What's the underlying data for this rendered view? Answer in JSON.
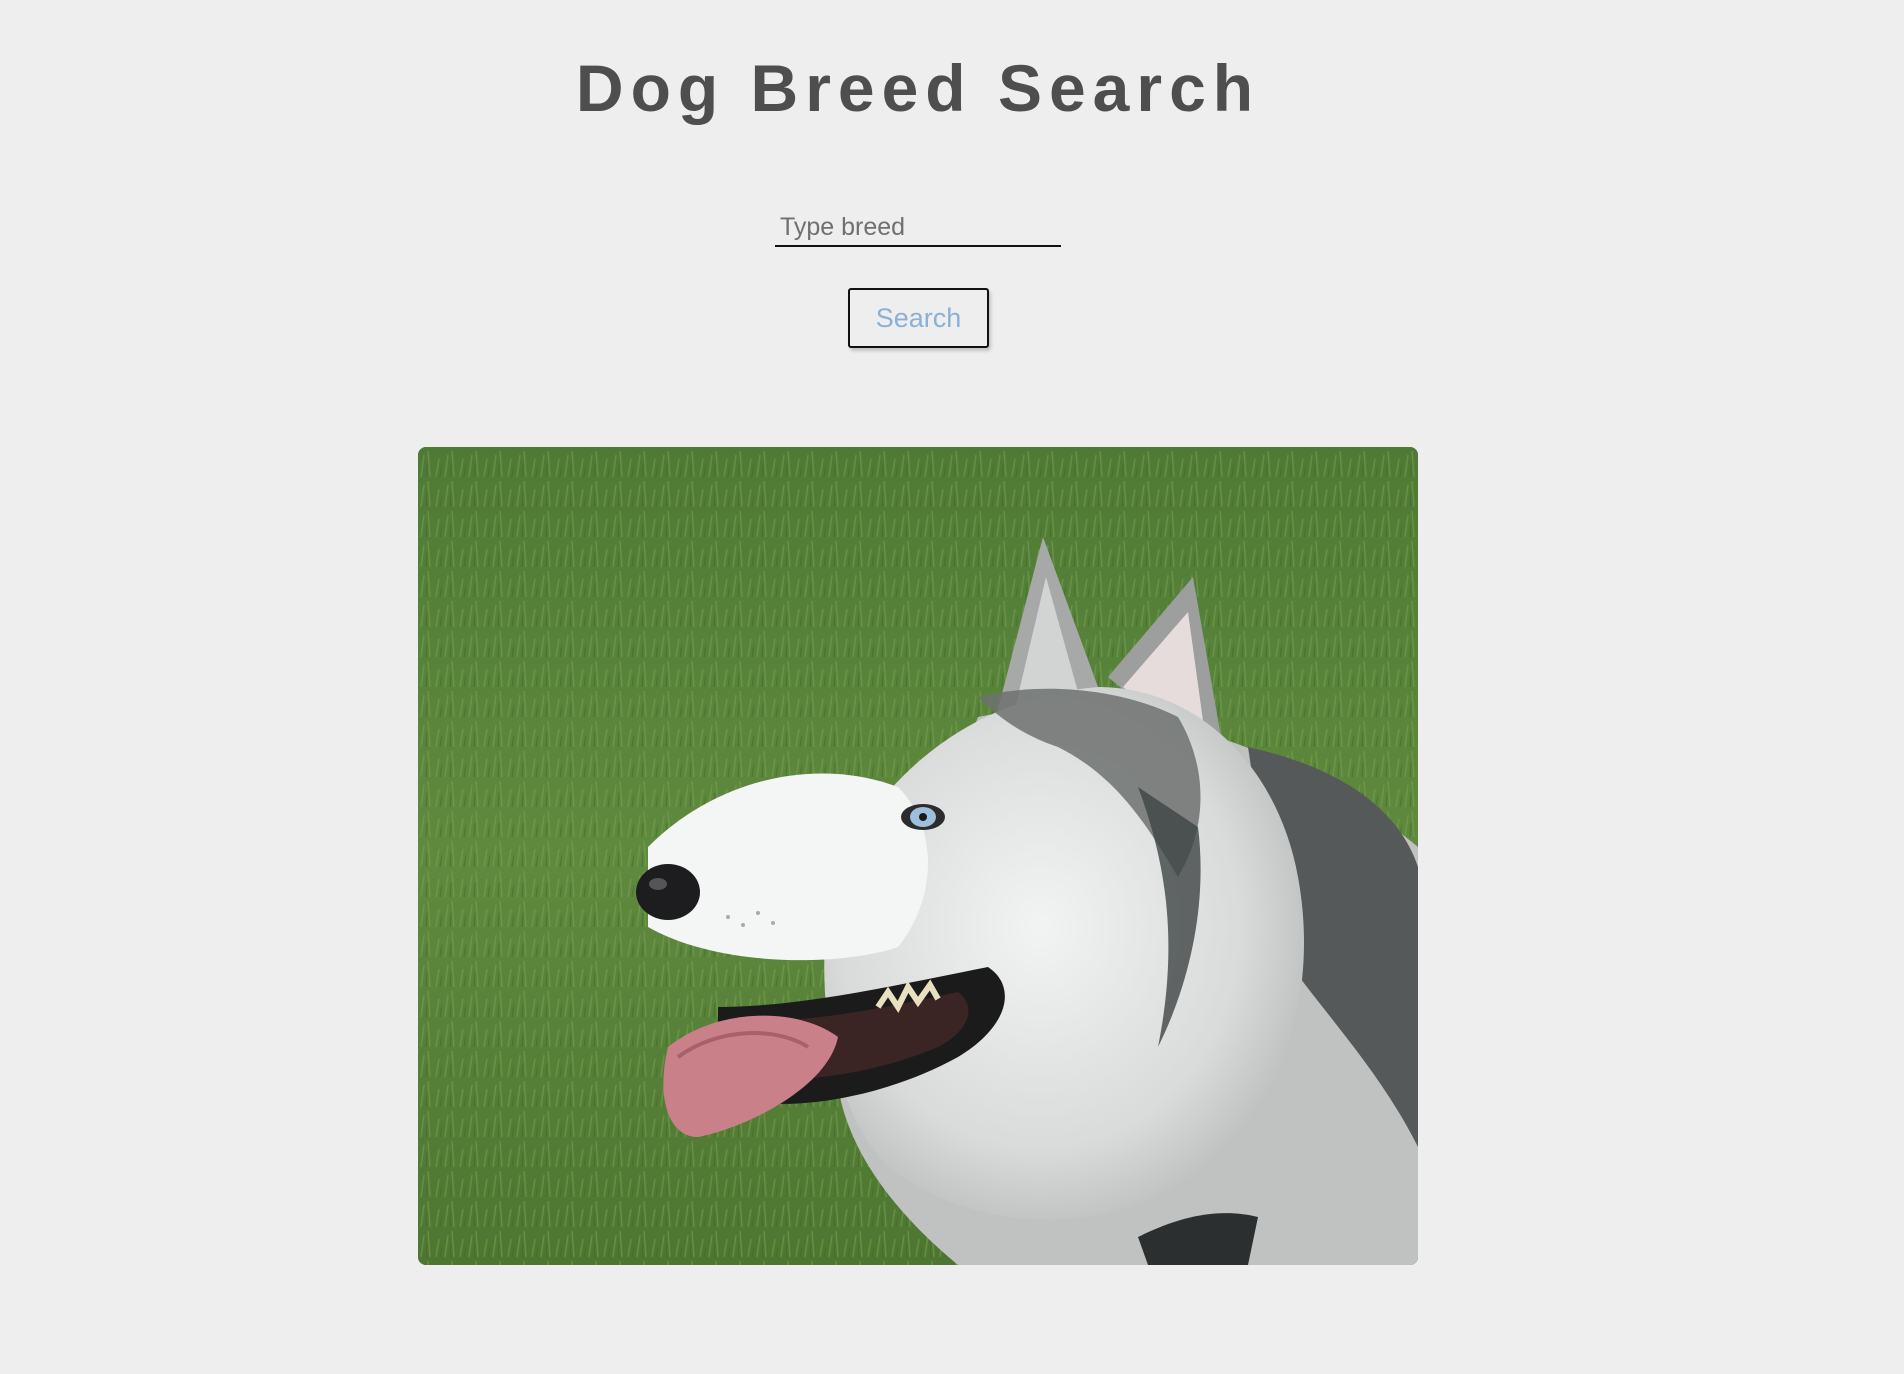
{
  "header": {
    "title": "Dog Breed Search"
  },
  "search": {
    "placeholder": "Type breed",
    "value": "",
    "button_label": "Search"
  },
  "result": {
    "image_icon": "husky-photo"
  },
  "colors": {
    "background": "#eeeeee",
    "title": "#4e4e4e",
    "button_text": "#8ab0d8"
  }
}
